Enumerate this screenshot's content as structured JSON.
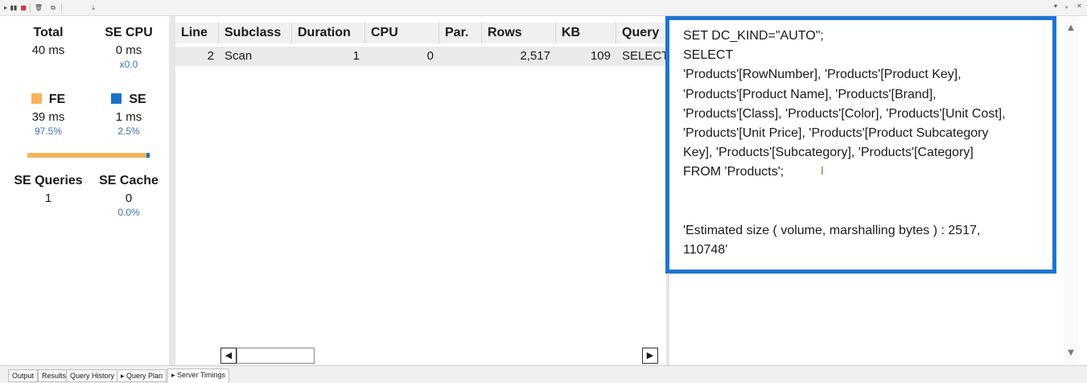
{
  "toolbar": {
    "buttons": [
      "play-icon",
      "pause-icon",
      "stop-icon",
      "clear-icon",
      "copy-icon",
      "export-icon"
    ],
    "right_controls": [
      "dropdown-arrow-icon",
      "pin-icon",
      "close-icon"
    ],
    "right_glyphs": [
      "▾",
      "ᵩ",
      "✕"
    ]
  },
  "summary": {
    "total": {
      "label": "Total",
      "value": "40 ms"
    },
    "se_cpu": {
      "label": "SE CPU",
      "value": "0 ms",
      "ratio": "x0.0"
    },
    "fe": {
      "label": "FE",
      "value": "39 ms",
      "pct": "97.5%",
      "color": "#f7b55a"
    },
    "se": {
      "label": "SE",
      "value": "1 ms",
      "pct": "2.5%",
      "color": "#1a73c9"
    },
    "fe_se_split": {
      "fe_fraction": 0.975,
      "se_fraction": 0.025
    },
    "se_queries": {
      "label": "SE Queries",
      "value": "1"
    },
    "se_cache": {
      "label": "SE Cache",
      "value": "0",
      "pct": "0.0%"
    }
  },
  "grid": {
    "columns": [
      "Line",
      "Subclass",
      "Duration",
      "CPU",
      "Par.",
      "Rows",
      "KB",
      "Query"
    ],
    "rows": [
      {
        "line": "2",
        "subclass": "Scan",
        "duration": "1",
        "cpu": "0",
        "par": "",
        "rows": "2,517",
        "kb": "109",
        "query": "SELECT"
      }
    ]
  },
  "detail": {
    "query_text": "SET DC_KIND=\"AUTO\";\nSELECT\n'Products'[RowNumber], 'Products'[Product Key],\n'Products'[Product Name], 'Products'[Brand],\n'Products'[Class], 'Products'[Color], 'Products'[Unit Cost],\n'Products'[Unit Price], 'Products'[Product Subcategory\nKey], 'Products'[Subcategory], 'Products'[Category]\nFROM 'Products';\n\n\n'Estimated size ( volume, marshalling bytes ) : 2517,\n110748'"
  },
  "tabs": [
    "Output",
    "Results",
    "Query History",
    "Query Plan",
    "Server Timings"
  ],
  "active_tab": "Server Timings",
  "colors": {
    "highlight_border": "#1f74d1"
  }
}
